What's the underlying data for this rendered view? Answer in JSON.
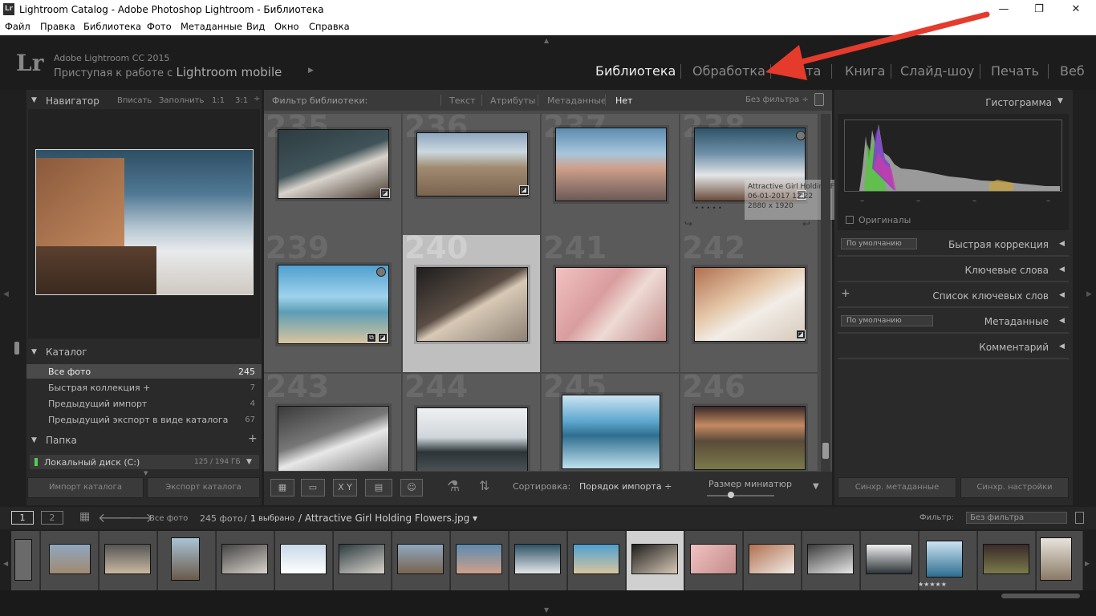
{
  "window": {
    "title": "Lightroom Catalog - Adobe Photoshop Lightroom - Библиотека",
    "app_icon": "Lr",
    "minimize": "—",
    "maximize": "❐",
    "close": "✕"
  },
  "menu": [
    "Файл",
    "Правка",
    "Библиотека",
    "Фото",
    "Метаданные",
    "Вид",
    "Окно",
    "Справка"
  ],
  "identity": {
    "logo": "Lr",
    "line1": "Adobe Lightroom CC 2015",
    "line2_prefix": "Приступая к работе с",
    "line2_emph": "Lightroom mobile",
    "play": "▶"
  },
  "modules": [
    "Библиотека",
    "Обработка",
    "Карта",
    "Книга",
    "Слайд-шоу",
    "Печать",
    "Веб"
  ],
  "navigator": {
    "title": "Навигатор",
    "fit": "Вписать",
    "fill": "Заполнить",
    "z1": "1:1",
    "z3": "3:1"
  },
  "catalog": {
    "title": "Каталог",
    "items": [
      {
        "label": "Все фото",
        "count": "245"
      },
      {
        "label": "Быстрая коллекция  +",
        "count": "7"
      },
      {
        "label": "Предыдущий импорт",
        "count": "4"
      },
      {
        "label": "Предыдущий экспорт в виде каталога",
        "count": "67"
      }
    ]
  },
  "folders": {
    "title": "Папка",
    "add": "+",
    "disk": "Локальный диск (C:)",
    "disk_size": "125 / 194 ГБ"
  },
  "left_buttons": {
    "import": "Импорт каталога",
    "export": "Экспорт каталога"
  },
  "filter_bar": {
    "label": "Фильтр библиотеки:",
    "text": "Текст",
    "attribute": "Атрибуты",
    "metadata": "Метаданные",
    "none": "Нет",
    "preset": "Без фильтра ÷"
  },
  "grid": {
    "cell_numbers": [
      "235",
      "236",
      "237",
      "238",
      "239",
      "240",
      "241",
      "242",
      "243",
      "244",
      "245",
      "246"
    ],
    "tooltip_name": "Attractive Girl Holding Flowers.jpg",
    "tooltip_date": "06-01-2017 12:22",
    "tooltip_size": "2880 x 1920",
    "stars": "• • • • •"
  },
  "toolbar": {
    "sort_label": "Сортировка:",
    "sort_value": "Порядок импорта ÷",
    "thumb_size_label": "Размер миниатюр",
    "xy": "X Y"
  },
  "right_panel": {
    "histogram": "Гистограмма",
    "originals": "Оригиналы",
    "default1": "По умолчанию",
    "quick_develop": "Быстрая коррекция",
    "keywording": "Ключевые слова",
    "keyword_list": "Список ключевых слов",
    "plus": "+",
    "default2": "По умолчанию",
    "metadata": "Метаданные",
    "comments": "Комментарий",
    "sync_meta": "Синхр. метаданные",
    "sync_settings": "Синхр. настройки",
    "dash": "–"
  },
  "filmstrip_bar": {
    "page1": "1",
    "page2": "2",
    "all_photos": "Все фото",
    "count": "245 фото",
    "selected_count": "1",
    "selected_label": "выбрано",
    "path": "/ Attractive Girl Holding Flowers.jpg ▾",
    "filter_label": "Фильтр:",
    "filter_value": "Без фильтра"
  },
  "filmstrip": {
    "stars": "★★★★★"
  },
  "colors": {
    "accent_arrow": "#e53b2c",
    "panel": "#2a2a2a",
    "grid_bg": "#4a4a4a",
    "selected_cell": "#bfbfbf"
  }
}
